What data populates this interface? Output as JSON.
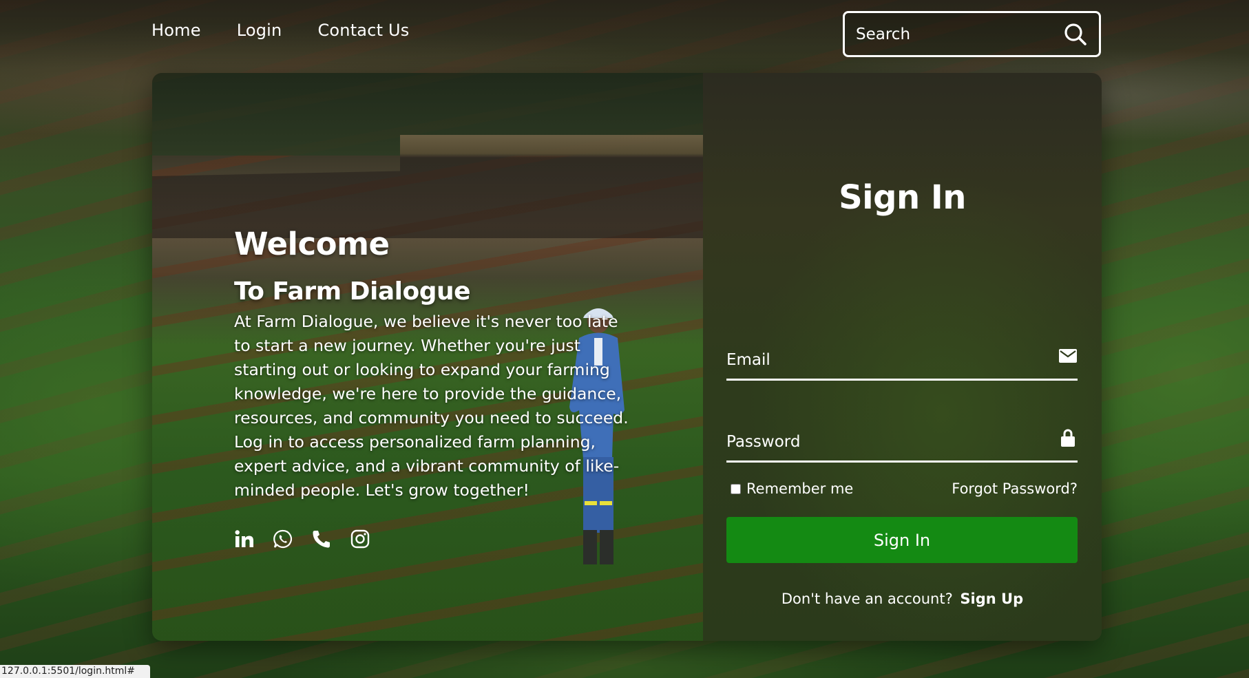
{
  "nav": {
    "items": [
      {
        "label": "Home"
      },
      {
        "label": "Login"
      },
      {
        "label": "Contact Us"
      }
    ]
  },
  "search": {
    "placeholder": "Search",
    "icon": "search-icon"
  },
  "welcome": {
    "title": "Welcome",
    "subtitle": "To Farm Dialogue",
    "body": "At Farm Dialogue, we believe it's never too late to start a new journey. Whether you're just starting out or looking to expand your farming knowledge, we're here to provide the guidance, resources, and community you need to succeed. Log in to access personalized farm planning, expert advice, and a vibrant community of like-minded people. Let's grow together!"
  },
  "socials": [
    {
      "name": "linkedin-icon"
    },
    {
      "name": "whatsapp-icon"
    },
    {
      "name": "phone-icon"
    },
    {
      "name": "instagram-icon"
    }
  ],
  "signin": {
    "title": "Sign In",
    "email_placeholder": "Email",
    "password_placeholder": "Password",
    "remember_label": "Remember me",
    "forgot_label": "Forgot Password?",
    "button_label": "Sign In",
    "no_account_text": "Don't have an account?",
    "signup_label": "Sign Up"
  },
  "colors": {
    "button_green": "#148a13",
    "text": "#ffffff"
  },
  "status_bar": {
    "url": "127.0.0.1:5501/login.html#"
  }
}
